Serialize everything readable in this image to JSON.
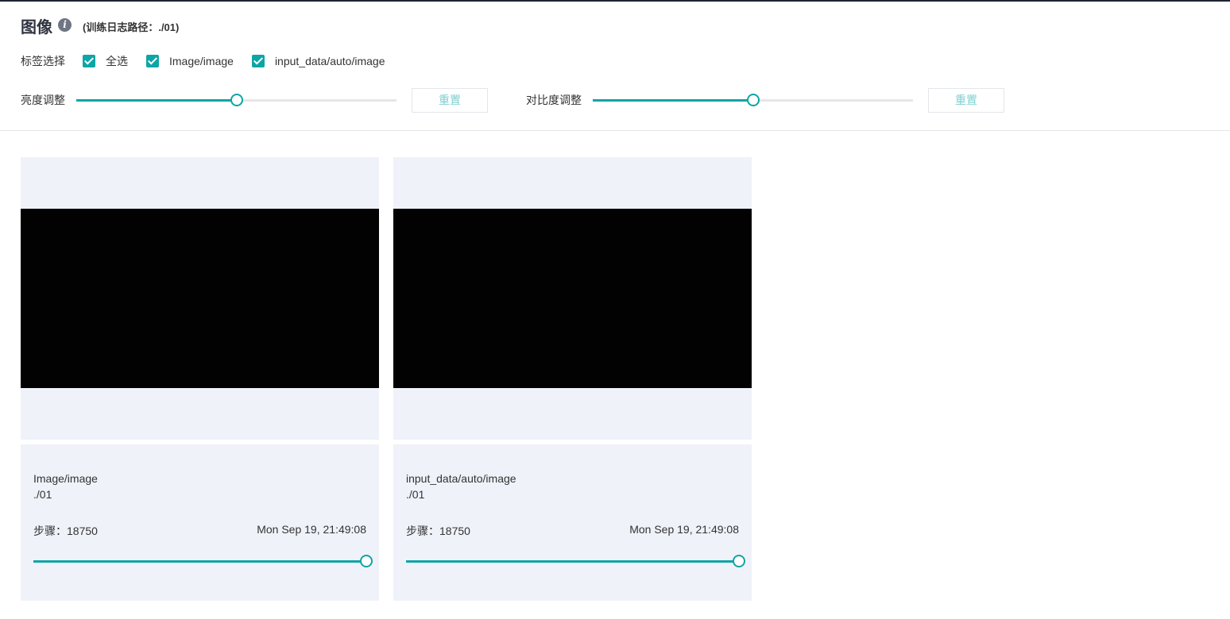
{
  "header": {
    "title": "图像",
    "info_icon": "info-icon",
    "log_path": "(训练日志路径：./01)"
  },
  "tags": {
    "label": "标签选择",
    "options": [
      {
        "label": "全选",
        "checked": true
      },
      {
        "label": "Image/image",
        "checked": true
      },
      {
        "label": "input_data/auto/image",
        "checked": true
      }
    ]
  },
  "adjust": {
    "brightness": {
      "label": "亮度调整",
      "value": 0.5,
      "reset_label": "重置"
    },
    "contrast": {
      "label": "对比度调整",
      "value": 0.5,
      "reset_label": "重置"
    }
  },
  "cards": [
    {
      "tag": "Image/image",
      "run": "./01",
      "step": "步骤：18750",
      "time": "Mon Sep 19, 21:49:08",
      "step_position": 1.0
    },
    {
      "tag": "input_data/auto/image",
      "run": "./01",
      "step": "步骤：18750",
      "time": "Mon Sep 19, 21:49:08",
      "step_position": 1.0
    }
  ],
  "colors": {
    "accent": "#0ea5a6",
    "card_bg": "#eff2f9"
  }
}
